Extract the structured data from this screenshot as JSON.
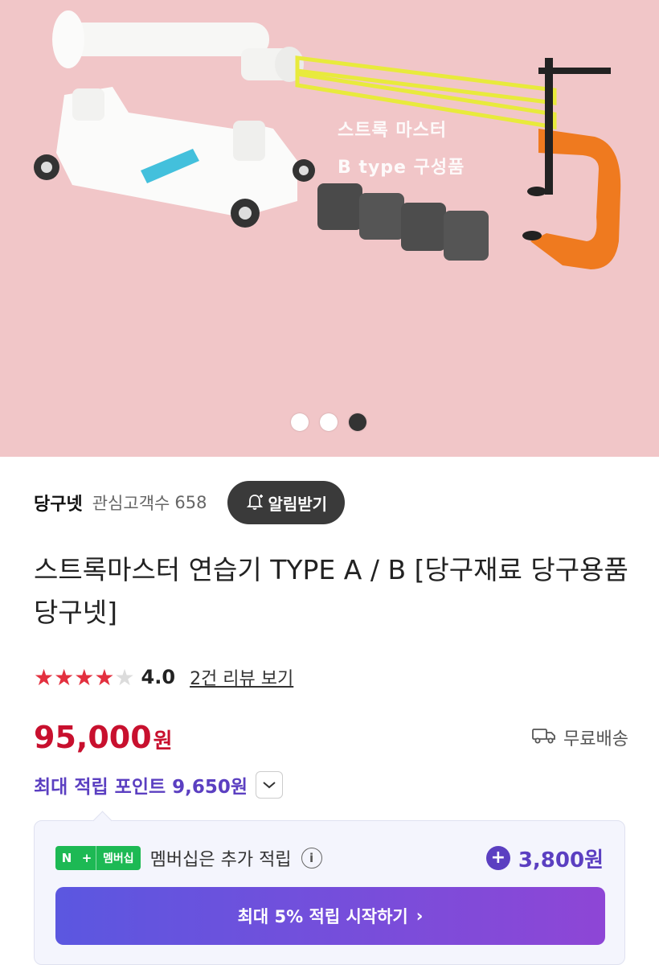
{
  "hero": {
    "caption_line1": "스트록 마스터",
    "caption_line2": "B type 구성품",
    "pagination": {
      "total": 3,
      "active_index": 2
    }
  },
  "store": {
    "name": "당구넷",
    "watchers_label": "관심고객수",
    "watchers_count": "658",
    "alarm_button": "알림받기"
  },
  "product": {
    "title": "스트록마스터 연습기 TYPE A / B [당구재료 당구용품 당구넷]",
    "rating": "4.0",
    "rating_fill": 0.8,
    "review_link": "2건 리뷰 보기",
    "price_number": "95,000",
    "price_unit": "원",
    "shipping": "무료배송",
    "points": "최대 적립 포인트 9,650원"
  },
  "membership": {
    "badge_n": "N",
    "badge_plus": "+",
    "badge_label": "멤버십",
    "text": "멤버십은 추가 적립",
    "info_glyph": "i",
    "plus_glyph": "+",
    "points": "3,800원",
    "cta": "최대 5% 적립 시작하기",
    "cta_chevron": "›"
  },
  "colors": {
    "hero_bg": "#f1c6c8",
    "price": "#c8102e",
    "points": "#5b3fc1",
    "naver_green": "#1db954",
    "cta_gradient_start": "#5b57e0",
    "cta_gradient_end": "#8e46d6"
  },
  "icons": [
    "bell-plus-icon",
    "star-icon",
    "truck-icon",
    "chevron-down-icon",
    "info-icon",
    "plus-circle-icon",
    "chevron-right-icon"
  ]
}
